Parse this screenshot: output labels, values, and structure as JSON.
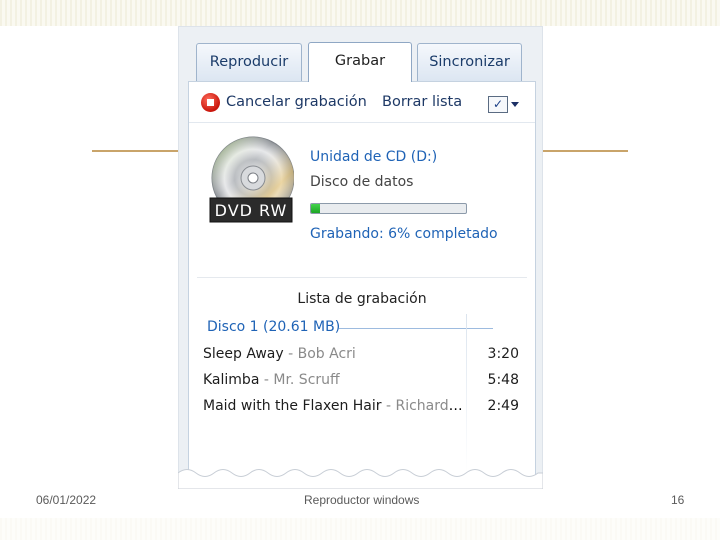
{
  "tabs": [
    {
      "label": "Reproducir",
      "active": false
    },
    {
      "label": "Grabar",
      "active": true
    },
    {
      "label": "Sincronizar",
      "active": false
    }
  ],
  "toolbar": {
    "cancel_label": "Cancelar grabación",
    "clear_label": "Borrar lista"
  },
  "disc": {
    "drive_name": "Unidad de CD (D:)",
    "type": "Disco de datos",
    "icon_label": "DVD RW",
    "progress": 0.06,
    "status": "Grabando: 6% completado"
  },
  "burn_list": {
    "title": "Lista de grabación",
    "disc_header": "Disco 1 (20.61 MB)",
    "tracks": [
      {
        "title": "Sleep Away",
        "sep": " - ",
        "artist": "Bob Acri",
        "duration": "3:20"
      },
      {
        "title": "Kalimba",
        "sep": " - ",
        "artist": "Mr. Scruff",
        "duration": "5:48"
      },
      {
        "title": "Maid with the Flaxen Hair",
        "sep": " - ",
        "artist": "Richard ...",
        "duration": "2:49"
      }
    ]
  },
  "footer": {
    "date": "06/01/2022",
    "title": "Reproductor windows",
    "page": "16"
  },
  "colors": {
    "accent_text": "#1f63b6",
    "progress_fill": "#1ea625",
    "stop_red": "#c9140a"
  }
}
